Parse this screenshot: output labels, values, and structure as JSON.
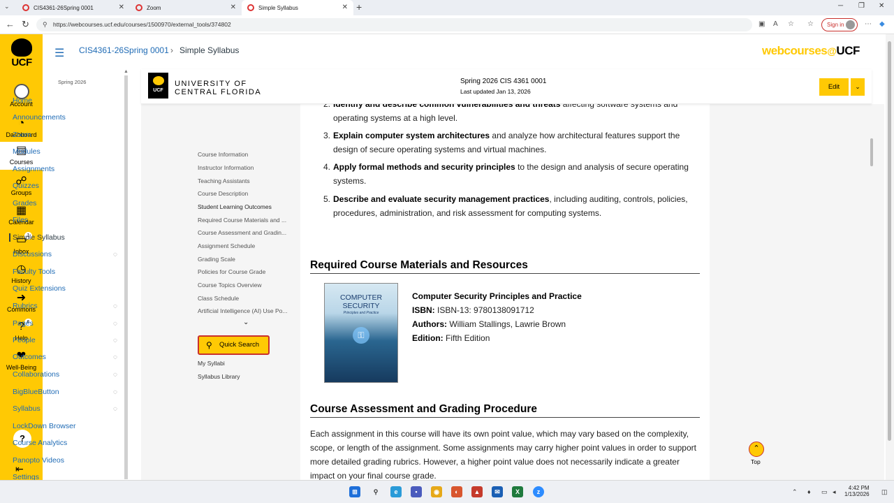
{
  "browser": {
    "tabs": [
      {
        "title": "CIS4361-26Spring 0001"
      },
      {
        "title": "Zoom"
      },
      {
        "title": "Simple Syllabus"
      }
    ],
    "url": "https://webcourses.ucf.edu/courses/1500970/external_tools/374802",
    "sign_in": "Sign in"
  },
  "global_nav": {
    "logo_text": "UCF",
    "items": [
      {
        "label": "Account",
        "icon": "account-icon"
      },
      {
        "label": "Dashboard",
        "icon": "dashboard-icon"
      },
      {
        "label": "Courses",
        "icon": "courses-icon"
      },
      {
        "label": "Groups",
        "icon": "groups-icon"
      },
      {
        "label": "Calendar",
        "icon": "calendar-icon"
      },
      {
        "label": "Inbox",
        "icon": "inbox-icon",
        "badge": "1"
      },
      {
        "label": "History",
        "icon": "history-icon"
      },
      {
        "label": "Commons",
        "icon": "commons-icon"
      },
      {
        "label": "Help",
        "icon": "help-icon",
        "badge": "6"
      },
      {
        "label": "Well-Being",
        "icon": "wellbeing-icon"
      }
    ],
    "help_glyph": "?",
    "accent": "#ffc904"
  },
  "header": {
    "course": "CIS4361-26Spring 0001",
    "separator": "›",
    "page": "Simple Syllabus",
    "brand_web": "webcourses",
    "brand_at": "@",
    "brand_ucf": "UCF"
  },
  "course_nav": {
    "term": "Spring 2026",
    "items": [
      {
        "label": "Home"
      },
      {
        "label": "Announcements"
      },
      {
        "label": "Zoom"
      },
      {
        "label": "Modules"
      },
      {
        "label": "Assignments"
      },
      {
        "label": "Quizzes"
      },
      {
        "label": "Grades"
      },
      {
        "label": "Files"
      },
      {
        "label": "Simple Syllabus",
        "active": true
      },
      {
        "label": "Discussions",
        "hidden": true
      },
      {
        "label": "Faculty Tools"
      },
      {
        "label": "Quiz Extensions"
      },
      {
        "label": "Rubrics",
        "hidden": true
      },
      {
        "label": "Pages",
        "hidden": true
      },
      {
        "label": "People",
        "hidden": true
      },
      {
        "label": "Outcomes",
        "hidden": true
      },
      {
        "label": "Collaborations",
        "hidden": true
      },
      {
        "label": "BigBlueButton",
        "hidden": true
      },
      {
        "label": "Syllabus",
        "hidden": true
      },
      {
        "label": "LockDown Browser"
      },
      {
        "label": "Course Analytics"
      },
      {
        "label": "Panopto Videos"
      },
      {
        "label": "Settings"
      }
    ]
  },
  "syllabus_header": {
    "university_line1": "UNIVERSITY OF",
    "university_line2": "CENTRAL FLORIDA",
    "badge_text": "UCF",
    "term_title": "Spring 2026 CIS 4361 0001",
    "updated": "Last updated Jan 13, 2026",
    "edit_label": "Edit"
  },
  "toc": {
    "items": [
      "Course Information",
      "Instructor Information",
      "Teaching Assistants",
      "Course Description",
      "Student Learning Outcomes",
      "Required Course Materials and ...",
      "Course Assessment and Gradin...",
      "Assignment Schedule",
      "Grading Scale",
      "Policies for Course Grade",
      "Course Topics Overview",
      "Class Schedule",
      "Artificial Intelligence (AI) Use Po..."
    ],
    "current_index": 4,
    "quick_search": "Quick Search",
    "my_syllabi": "My Syllabi",
    "syllabus_library": "Syllabus Library"
  },
  "outcomes": [
    {
      "num": "2.",
      "bold": "Identify and describe common vulnerabilities and threats",
      "rest": " affecting software systems and operating systems at a high level."
    },
    {
      "num": "3.",
      "bold": "Explain computer system architectures",
      "rest": " and analyze how architectural features support the design of secure operating systems and virtual machines."
    },
    {
      "num": "4.",
      "bold": "Apply formal methods and security principles",
      "rest": " to the design and analysis of secure operating systems."
    },
    {
      "num": "5.",
      "bold": "Describe and evaluate security management practices",
      "rest": ", including auditing, controls, policies, procedures, administration, and risk assessment for computing systems."
    }
  ],
  "materials": {
    "heading": "Required Course Materials and Resources",
    "book_title": "Computer Security Principles and Practice",
    "isbn_label": "ISBN:",
    "isbn": "ISBN-13: 9780138091712",
    "authors_label": "Authors:",
    "authors": "William Stallings, Lawrie Brown",
    "edition_label": "Edition:",
    "edition": "Fifth Edition",
    "cover_line1": "COMPUTER",
    "cover_line2": "SECURITY",
    "cover_line3": "Principles and Practice"
  },
  "assessment": {
    "heading": "Course Assessment and Grading Procedure",
    "text": "Each assignment in this course will have its own point value, which may vary based on the complexity, scope, or length of the assignment. Some assignments may carry higher point values in order to support more detailed grading rubrics. However, a higher point value does not necessarily indicate a greater impact on your final course grade."
  },
  "top_button": {
    "label": "Top"
  },
  "taskbar": {
    "time": "4:42 PM",
    "date": "1/13/2026"
  }
}
